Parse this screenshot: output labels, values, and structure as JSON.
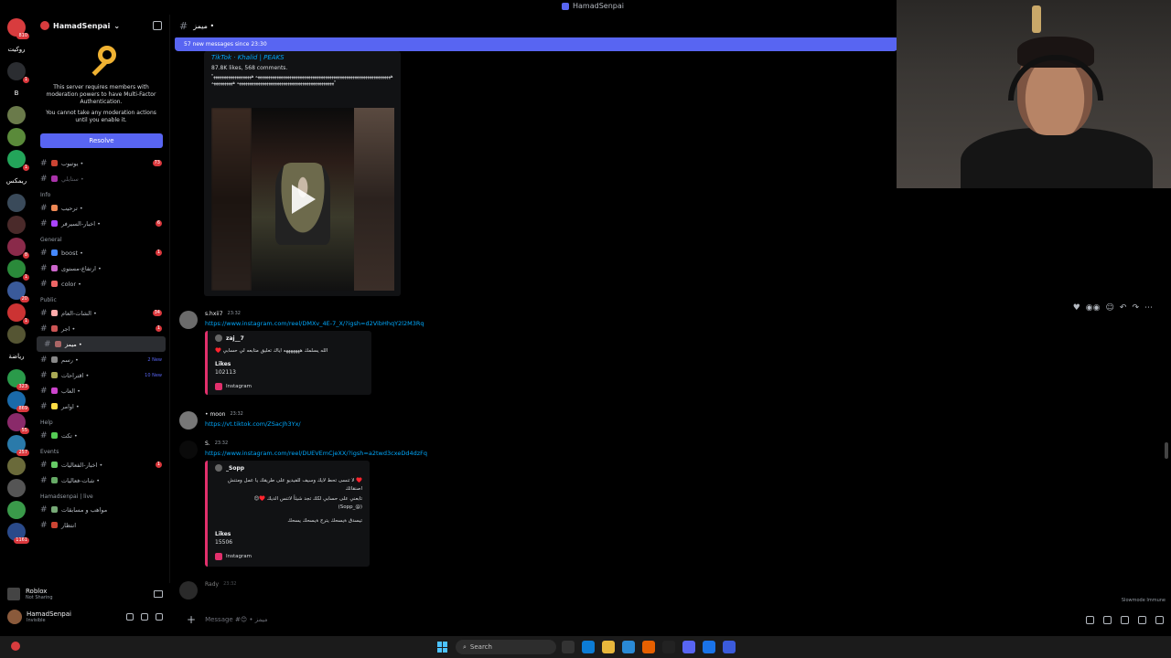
{
  "window": {
    "title": "HamadSenpai"
  },
  "rail": {
    "servers": [
      {
        "badge": "810"
      },
      {
        "label": "روكيت"
      },
      {
        "badge": "1"
      },
      {
        "label": "B"
      },
      {
        "badge": ""
      },
      {
        "badge": ""
      },
      {
        "badge": "1"
      },
      {
        "label": "ريمكس"
      },
      {
        "badge": ""
      },
      {
        "badge": ""
      },
      {
        "badge": "8"
      },
      {
        "badge": "1"
      },
      {
        "badge": "20"
      },
      {
        "badge": "1"
      },
      {
        "badge": ""
      },
      {
        "label": "رياضة"
      },
      {
        "badge": "323"
      },
      {
        "badge": "869"
      },
      {
        "badge": "55"
      },
      {
        "badge": "257"
      },
      {
        "badge": ""
      },
      {
        "badge": ""
      },
      {
        "badge": ""
      },
      {
        "badge": "1161"
      }
    ]
  },
  "sidebar": {
    "server_name": "HamadSenpai",
    "mfa_text": "This server requires members with moderation powers to have Multi-Factor Authentication.",
    "mfa_text2": "You cannot take any moderation actions until you enable it.",
    "resolve_label": "Resolve",
    "top_channels": [
      {
        "name": "يوتيوب •",
        "count": "73"
      },
      {
        "name": "ستايلي •",
        "muted": true
      }
    ],
    "cat_info": "Info",
    "info_channels": [
      {
        "name": "ترحيب •"
      },
      {
        "name": "اخبار-السيرفر •",
        "count": "6"
      }
    ],
    "cat_general": "General",
    "general_channels": [
      {
        "name": "boost •",
        "count": "1"
      },
      {
        "name": "ارتفاع-مستوى •"
      },
      {
        "name": "color •"
      }
    ],
    "cat_public": "Public",
    "public_channels": [
      {
        "name": "الشات-العام •",
        "count": "34"
      },
      {
        "name": "اجر •",
        "count": "1"
      },
      {
        "name": "ميمز •",
        "active": true
      },
      {
        "name": "رسم •",
        "new": "2 New"
      },
      {
        "name": "اقتراحات •",
        "new": "10 New"
      },
      {
        "name": "العاب •"
      },
      {
        "name": "اوامر •"
      }
    ],
    "cat_help": "Help",
    "help_channels": [
      {
        "name": "تكت •"
      }
    ],
    "cat_events": "Events",
    "events_channels": [
      {
        "name": "اخبار-الفعاليات •",
        "count": "1"
      },
      {
        "name": "شات-فعاليات •"
      }
    ],
    "cat_live": "Hamadsenpai | live",
    "live_channels": [
      {
        "name": "مواهب و مسابقات"
      },
      {
        "name": "انتظار"
      }
    ]
  },
  "user_panel": {
    "activity_name": "Roblox",
    "activity_sub": "Not Sharing",
    "username": "HamadSenpai",
    "status": "Invisible"
  },
  "chat": {
    "channel_name": "ميمز •",
    "new_messages_bar": "57 new messages since 23:30",
    "tiktok": {
      "provider": "TikTok · Khalid | PEAKS",
      "stats": "87.8K likes, 568 comments.",
      "desc": "\"ههههههههههههههههههههههههههههههههههههههههههههههههههههههههههههههههه ههههههههههههههههههههههههههههههههههههههههههههههههههههههههههههههههه ههههههههههه\""
    },
    "messages": [
      {
        "author": "s.hxii7",
        "time": "23:32",
        "link": "https://www.instagram.com/reel/DMXv_4E-7_X/?igsh=d2VibHhqY2l2M3Rq",
        "embed": {
          "account": "zaj__7",
          "text": "♥️ الله يسلمك هههههههه اياك تعليق متابعه لي حسابي",
          "likes_label": "Likes",
          "likes": "102113",
          "footer": "Instagram"
        }
      },
      {
        "author": "• moon",
        "time": "23:32",
        "link": "https://vt.tiktok.com/ZSacJh3Yx/"
      },
      {
        "author": "S.",
        "time": "23:32",
        "link": "https://www.instagram.com/reel/DUEVEmCjeXX/?igsh=a2twd3cxeDd4dzFq",
        "embed": {
          "account": "_Sopp",
          "text1": "♥️ لا تنسى تحط لايك وسيف للفيديو على طريقك يا عمل ومتنش اصنقائك",
          "text2": "تابعني على حسابي لكك تجد شيئاً لاتنس الديك ♥️😊",
          "text3": "(@_Sopp)",
          "text4": "تيسدق ةيسحك يترج ةيسحك يسحك",
          "likes_label": "Likes",
          "likes": "15506",
          "footer": "Instagram"
        }
      },
      {
        "author": "Rady",
        "time": "23:32"
      }
    ],
    "composer_placeholder": "Message #😊 • ميمز",
    "slowmode": "Slowmode Immune"
  },
  "taskbar": {
    "search_placeholder": "Search"
  }
}
